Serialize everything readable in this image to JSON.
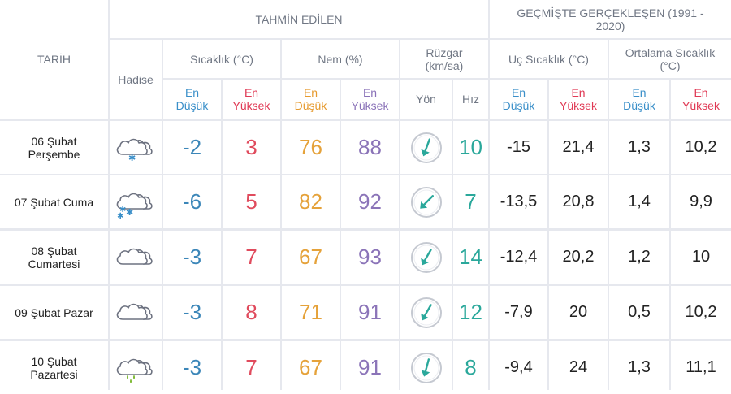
{
  "header": {
    "tarih": "TARİH",
    "tahmin": "TAHMİN EDİLEN",
    "gecmis": "GEÇMİŞTE GERÇEKLEŞEN (1991 - 2020)",
    "hadise": "Hadise",
    "sicaklik": "Sıcaklık (°C)",
    "nem": "Nem (%)",
    "ruzgar": "Rüzgar (km/sa)",
    "uc_sicaklik": "Uç Sıcaklık (°C)",
    "ort_sicaklik": "Ortalama Sıcaklık (°C)",
    "en_dusuk": "En Düşük",
    "en_yuksek": "En Yüksek",
    "yon": "Yön",
    "hiz": "Hız"
  },
  "rows": [
    {
      "date": "06 Şubat Perşembe",
      "icon": "cloud-snow-icon",
      "tmin": "-2",
      "tmax": "3",
      "hmin": "76",
      "hmax": "88",
      "wind_dir_deg": 200,
      "wind": "10",
      "uc_min": "-15",
      "uc_max": "21,4",
      "ort_min": "1,3",
      "ort_max": "10,2"
    },
    {
      "date": "07 Şubat Cuma",
      "icon": "cloud-heavy-snow-icon",
      "tmin": "-6",
      "tmax": "5",
      "hmin": "82",
      "hmax": "92",
      "wind_dir_deg": 225,
      "wind": "7",
      "uc_min": "-13,5",
      "uc_max": "20,8",
      "ort_min": "1,4",
      "ort_max": "9,9"
    },
    {
      "date": "08 Şubat Cumartesi",
      "icon": "cloud-icon",
      "tmin": "-3",
      "tmax": "7",
      "hmin": "67",
      "hmax": "93",
      "wind_dir_deg": 210,
      "wind": "14",
      "uc_min": "-12,4",
      "uc_max": "20,2",
      "ort_min": "1,2",
      "ort_max": "10"
    },
    {
      "date": "09 Şubat Pazar",
      "icon": "cloud-icon",
      "tmin": "-3",
      "tmax": "8",
      "hmin": "71",
      "hmax": "91",
      "wind_dir_deg": 210,
      "wind": "12",
      "uc_min": "-7,9",
      "uc_max": "20",
      "ort_min": "0,5",
      "ort_max": "10,2"
    },
    {
      "date": "10 Şubat Pazartesi",
      "icon": "cloud-rain-icon",
      "tmin": "-3",
      "tmax": "7",
      "hmin": "67",
      "hmax": "91",
      "wind_dir_deg": 195,
      "wind": "8",
      "uc_min": "-9,4",
      "uc_max": "24",
      "ort_min": "1,3",
      "ort_max": "11,1"
    }
  ],
  "colors": {
    "grid": "#e6e8ee",
    "header_text": "#707784",
    "min": "#3a8fc9",
    "max": "#e03a55",
    "hum_min": "#e69a2e",
    "hum_max": "#8a72b8",
    "wind": "#2aa89b"
  }
}
